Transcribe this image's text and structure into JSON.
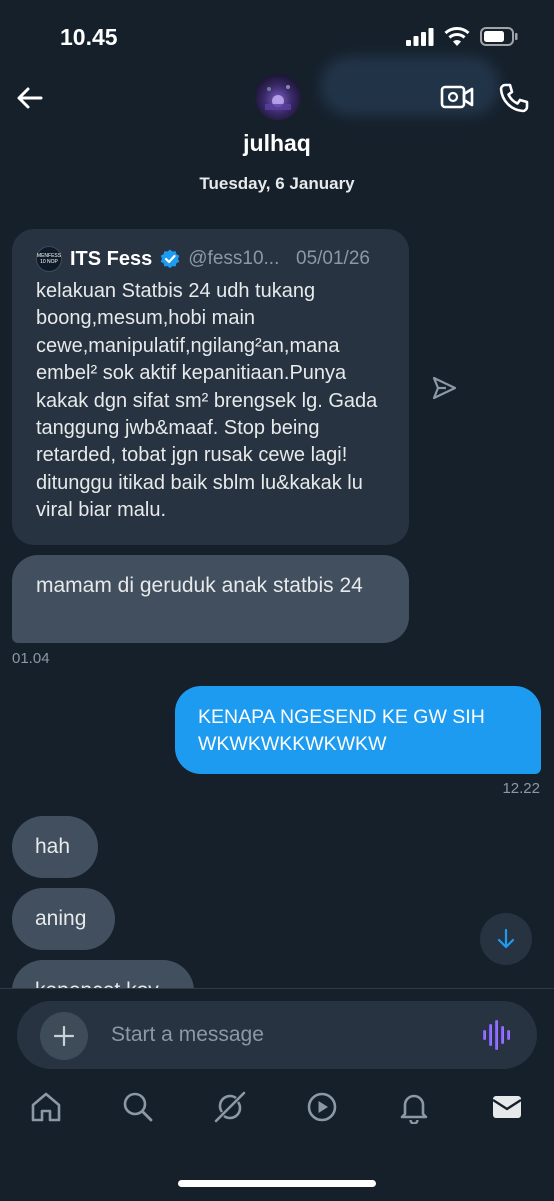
{
  "status_bar": {
    "time": "10.45"
  },
  "header": {
    "contact_name": "julhaq",
    "date_label": "Tuesday, 6 January"
  },
  "shared_post": {
    "account_name": "ITS Fess",
    "handle": "@fess10...",
    "date": "05/01/26",
    "logo_text": "MENFESS 10 NOP",
    "text": "kelakuan Statbis 24 udh tukang boong,mesum,hobi main cewe,manipulatif,ngilang²an,mana embel² sok aktif kepanitiaan.Punya kakak dgn sifat sm² brengsek lg. Gada tanggung jwb&maaf. Stop being retarded, tobat jgn rusak cewe lagi! ditunggu itikad baik sblm lu&kakak lu viral biar malu."
  },
  "messages": [
    {
      "side": "received",
      "text": "mamam di geruduk anak statbis 24",
      "time": "01.04"
    },
    {
      "side": "sent",
      "text": "KENAPA NGESEND KE GW SIH WKWKWKKWKWKW",
      "time": "12.22"
    },
    {
      "side": "received",
      "text": "hah"
    },
    {
      "side": "received",
      "text": "aning"
    },
    {
      "side": "received",
      "text": "kepencet kov"
    }
  ],
  "composer": {
    "placeholder": "Start a message"
  },
  "icons": {
    "back": "back-arrow-icon",
    "video": "video-call-icon",
    "phone": "phone-call-icon",
    "share": "share-icon",
    "scroll": "arrow-down-icon",
    "add": "plus-icon",
    "voice": "voice-message-icon",
    "nav": [
      "home-icon",
      "search-icon",
      "grok-icon",
      "video-icon",
      "notifications-icon",
      "messages-icon"
    ]
  },
  "colors": {
    "background": "#15202b",
    "sent_bubble": "#1d9bf0",
    "received_bubble": "#414f5e",
    "accent": "#1d9bf0"
  }
}
